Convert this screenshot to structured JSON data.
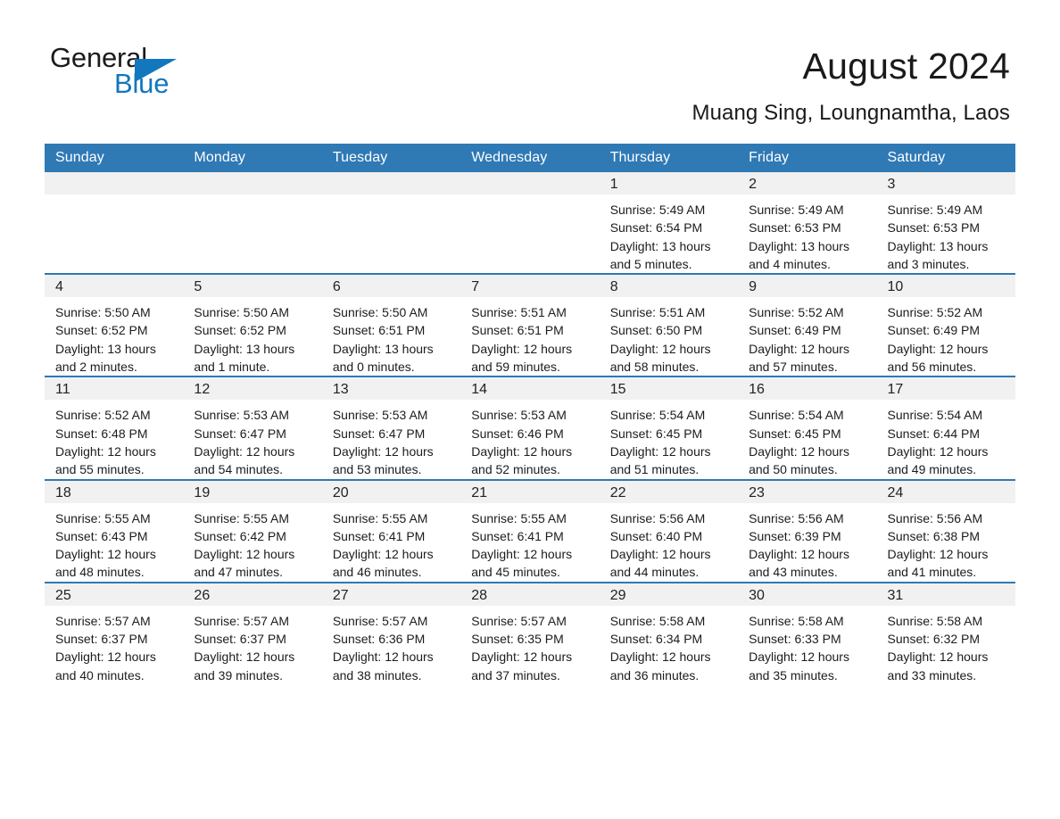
{
  "logo": {
    "word1": "General",
    "word2": "Blue",
    "triangle_color": "#1277bd"
  },
  "header": {
    "month_title": "August 2024",
    "location": "Muang Sing, Loungnamtha, Laos"
  },
  "colors": {
    "header_blue": "#2f79b5",
    "daynum_band": "#f1f1f1",
    "logo_blue": "#1277bd"
  },
  "weekday_headers": [
    "Sunday",
    "Monday",
    "Tuesday",
    "Wednesday",
    "Thursday",
    "Friday",
    "Saturday"
  ],
  "weeks": [
    [
      {
        "day": "",
        "empty": true
      },
      {
        "day": "",
        "empty": true
      },
      {
        "day": "",
        "empty": true
      },
      {
        "day": "",
        "empty": true
      },
      {
        "day": "1",
        "sunrise": "Sunrise: 5:49 AM",
        "sunset": "Sunset: 6:54 PM",
        "daylight": "Daylight: 13 hours and 5 minutes."
      },
      {
        "day": "2",
        "sunrise": "Sunrise: 5:49 AM",
        "sunset": "Sunset: 6:53 PM",
        "daylight": "Daylight: 13 hours and 4 minutes."
      },
      {
        "day": "3",
        "sunrise": "Sunrise: 5:49 AM",
        "sunset": "Sunset: 6:53 PM",
        "daylight": "Daylight: 13 hours and 3 minutes."
      }
    ],
    [
      {
        "day": "4",
        "sunrise": "Sunrise: 5:50 AM",
        "sunset": "Sunset: 6:52 PM",
        "daylight": "Daylight: 13 hours and 2 minutes."
      },
      {
        "day": "5",
        "sunrise": "Sunrise: 5:50 AM",
        "sunset": "Sunset: 6:52 PM",
        "daylight": "Daylight: 13 hours and 1 minute."
      },
      {
        "day": "6",
        "sunrise": "Sunrise: 5:50 AM",
        "sunset": "Sunset: 6:51 PM",
        "daylight": "Daylight: 13 hours and 0 minutes."
      },
      {
        "day": "7",
        "sunrise": "Sunrise: 5:51 AM",
        "sunset": "Sunset: 6:51 PM",
        "daylight": "Daylight: 12 hours and 59 minutes."
      },
      {
        "day": "8",
        "sunrise": "Sunrise: 5:51 AM",
        "sunset": "Sunset: 6:50 PM",
        "daylight": "Daylight: 12 hours and 58 minutes."
      },
      {
        "day": "9",
        "sunrise": "Sunrise: 5:52 AM",
        "sunset": "Sunset: 6:49 PM",
        "daylight": "Daylight: 12 hours and 57 minutes."
      },
      {
        "day": "10",
        "sunrise": "Sunrise: 5:52 AM",
        "sunset": "Sunset: 6:49 PM",
        "daylight": "Daylight: 12 hours and 56 minutes."
      }
    ],
    [
      {
        "day": "11",
        "sunrise": "Sunrise: 5:52 AM",
        "sunset": "Sunset: 6:48 PM",
        "daylight": "Daylight: 12 hours and 55 minutes."
      },
      {
        "day": "12",
        "sunrise": "Sunrise: 5:53 AM",
        "sunset": "Sunset: 6:47 PM",
        "daylight": "Daylight: 12 hours and 54 minutes."
      },
      {
        "day": "13",
        "sunrise": "Sunrise: 5:53 AM",
        "sunset": "Sunset: 6:47 PM",
        "daylight": "Daylight: 12 hours and 53 minutes."
      },
      {
        "day": "14",
        "sunrise": "Sunrise: 5:53 AM",
        "sunset": "Sunset: 6:46 PM",
        "daylight": "Daylight: 12 hours and 52 minutes."
      },
      {
        "day": "15",
        "sunrise": "Sunrise: 5:54 AM",
        "sunset": "Sunset: 6:45 PM",
        "daylight": "Daylight: 12 hours and 51 minutes."
      },
      {
        "day": "16",
        "sunrise": "Sunrise: 5:54 AM",
        "sunset": "Sunset: 6:45 PM",
        "daylight": "Daylight: 12 hours and 50 minutes."
      },
      {
        "day": "17",
        "sunrise": "Sunrise: 5:54 AM",
        "sunset": "Sunset: 6:44 PM",
        "daylight": "Daylight: 12 hours and 49 minutes."
      }
    ],
    [
      {
        "day": "18",
        "sunrise": "Sunrise: 5:55 AM",
        "sunset": "Sunset: 6:43 PM",
        "daylight": "Daylight: 12 hours and 48 minutes."
      },
      {
        "day": "19",
        "sunrise": "Sunrise: 5:55 AM",
        "sunset": "Sunset: 6:42 PM",
        "daylight": "Daylight: 12 hours and 47 minutes."
      },
      {
        "day": "20",
        "sunrise": "Sunrise: 5:55 AM",
        "sunset": "Sunset: 6:41 PM",
        "daylight": "Daylight: 12 hours and 46 minutes."
      },
      {
        "day": "21",
        "sunrise": "Sunrise: 5:55 AM",
        "sunset": "Sunset: 6:41 PM",
        "daylight": "Daylight: 12 hours and 45 minutes."
      },
      {
        "day": "22",
        "sunrise": "Sunrise: 5:56 AM",
        "sunset": "Sunset: 6:40 PM",
        "daylight": "Daylight: 12 hours and 44 minutes."
      },
      {
        "day": "23",
        "sunrise": "Sunrise: 5:56 AM",
        "sunset": "Sunset: 6:39 PM",
        "daylight": "Daylight: 12 hours and 43 minutes."
      },
      {
        "day": "24",
        "sunrise": "Sunrise: 5:56 AM",
        "sunset": "Sunset: 6:38 PM",
        "daylight": "Daylight: 12 hours and 41 minutes."
      }
    ],
    [
      {
        "day": "25",
        "sunrise": "Sunrise: 5:57 AM",
        "sunset": "Sunset: 6:37 PM",
        "daylight": "Daylight: 12 hours and 40 minutes."
      },
      {
        "day": "26",
        "sunrise": "Sunrise: 5:57 AM",
        "sunset": "Sunset: 6:37 PM",
        "daylight": "Daylight: 12 hours and 39 minutes."
      },
      {
        "day": "27",
        "sunrise": "Sunrise: 5:57 AM",
        "sunset": "Sunset: 6:36 PM",
        "daylight": "Daylight: 12 hours and 38 minutes."
      },
      {
        "day": "28",
        "sunrise": "Sunrise: 5:57 AM",
        "sunset": "Sunset: 6:35 PM",
        "daylight": "Daylight: 12 hours and 37 minutes."
      },
      {
        "day": "29",
        "sunrise": "Sunrise: 5:58 AM",
        "sunset": "Sunset: 6:34 PM",
        "daylight": "Daylight: 12 hours and 36 minutes."
      },
      {
        "day": "30",
        "sunrise": "Sunrise: 5:58 AM",
        "sunset": "Sunset: 6:33 PM",
        "daylight": "Daylight: 12 hours and 35 minutes."
      },
      {
        "day": "31",
        "sunrise": "Sunrise: 5:58 AM",
        "sunset": "Sunset: 6:32 PM",
        "daylight": "Daylight: 12 hours and 33 minutes."
      }
    ]
  ]
}
